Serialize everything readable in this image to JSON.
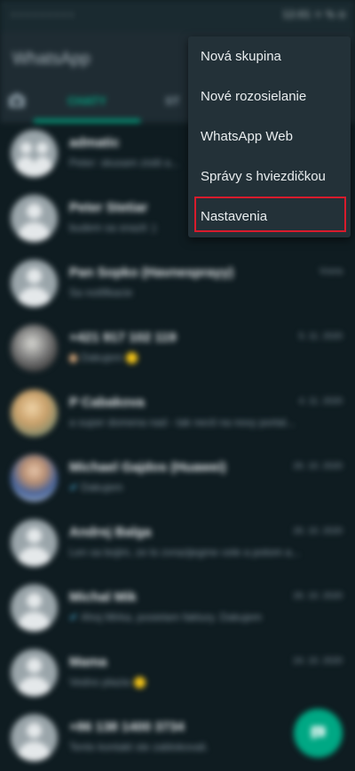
{
  "status_bar": {
    "left_text": "◦◦◦◦◦◦◦◦◦",
    "right_text": "12:01 ☼ % ⊙"
  },
  "app": {
    "title": "WhatsApp"
  },
  "tabs": {
    "chats": "CHATY",
    "status": "ST"
  },
  "chats": [
    {
      "name": "admatic",
      "preview": "Peter: skusam zistit a...",
      "time": "",
      "avatar": "group-icon"
    },
    {
      "name": "Peter Stetiar",
      "preview": "budem sa snazit :)",
      "time": "",
      "avatar": "person-icon"
    },
    {
      "name": "Pan Sopko (Havnesprayy)",
      "preview": "Sa notifikacie",
      "time": "Vcera",
      "avatar": "person-icon"
    },
    {
      "name": "+421 917 102 119",
      "preview": "Dakujem",
      "time": "5. 11. 2020",
      "avatar": "photo"
    },
    {
      "name": "P Cabakova",
      "preview": "a super domena nad - tak necit na novy portal...",
      "time": "4. 11. 2020",
      "avatar": "photo"
    },
    {
      "name": "Michael Gajdos (Huawei)",
      "preview": "Dakujem",
      "time": "26. 10. 2020",
      "avatar": "photo"
    },
    {
      "name": "Andrej Balga",
      "preview": "Len sa bojim, ze to zvrazijegme cele a potom a...",
      "time": "26. 10. 2020",
      "avatar": "person-icon"
    },
    {
      "name": "Michal Mik",
      "preview": "Ahoj Mirka, posielam faktury. Dakujem",
      "time": "26. 10. 2020",
      "avatar": "person-icon"
    },
    {
      "name": "Mama",
      "preview": "Vedno plazia",
      "time": "24. 10. 2020",
      "avatar": "person-icon"
    },
    {
      "name": "+86 138 1400 3734",
      "preview": "Tento kontakt ste zablokovali.",
      "time": "",
      "avatar": "person-icon"
    }
  ],
  "menu": {
    "items": [
      {
        "label": "Nová skupina"
      },
      {
        "label": "Nové rozosielanie"
      },
      {
        "label": "WhatsApp Web"
      },
      {
        "label": "Správy s hviezdičkou"
      },
      {
        "label": "Nastavenia"
      }
    ],
    "highlighted_index": 4
  },
  "colors": {
    "accent": "#00a884",
    "background": "#0f1c21",
    "menu_background": "#233138",
    "highlight_border": "#d81b2c"
  },
  "icons": {
    "fab": "new-chat-icon",
    "camera": "camera-icon"
  }
}
